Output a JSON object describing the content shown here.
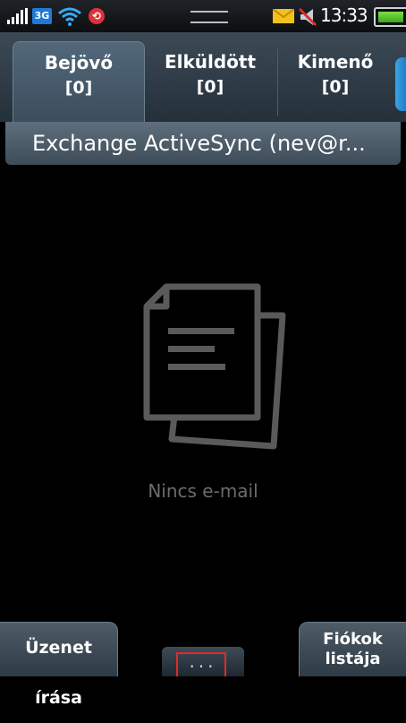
{
  "status_bar": {
    "network": "3G",
    "time": "13:33",
    "icons": [
      "signal-icon",
      "3g-icon",
      "wifi-icon",
      "sync-icon",
      "notification-handle",
      "mail-icon",
      "mute-icon",
      "battery-icon"
    ],
    "battery_level": 0.85,
    "colors": {
      "badge_3g": "#1e7ad6",
      "sync": "#e0303a",
      "mail": "#f2c21a",
      "battery": "#3ea81a"
    }
  },
  "tabs": [
    {
      "label": "Bejövő",
      "count": "[0]",
      "active": true
    },
    {
      "label": "Elküldött",
      "count": "[0]",
      "active": false
    },
    {
      "label": "Kimenő",
      "count": "[0]",
      "active": false
    }
  ],
  "account": {
    "title": "Exchange ActiveSync (nev@r..."
  },
  "empty_state": {
    "icon": "documents-icon",
    "message": "Nincs e-mail"
  },
  "bottom_bar": {
    "compose_label": "Üzenet írása",
    "more_label": "...",
    "accounts_line1": "Fiókok",
    "accounts_line2": "listája"
  }
}
